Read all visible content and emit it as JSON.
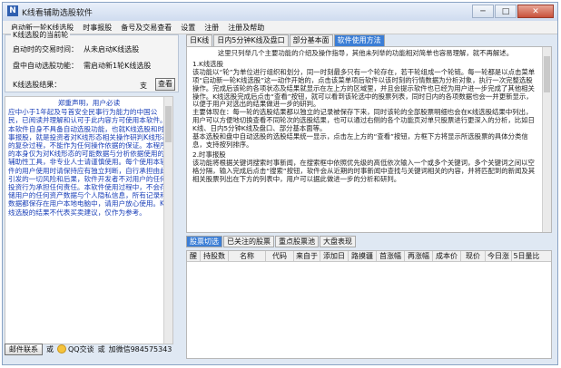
{
  "window": {
    "title": "K线看辅助选股软件",
    "minimize": "─",
    "maximize": "□",
    "close": "✕"
  },
  "menu": [
    "启动新一轮K线选股",
    "时事报股",
    "备号及交易查看",
    "设置",
    "注册",
    "注册及帮助"
  ],
  "left": {
    "group_title": "K线选股的当前轮",
    "start_time_label": "启动时的交易时间：",
    "start_time_value": "从未启动K线选股",
    "step_label": "盘中自动选股功能：",
    "step_value": "需启动新1轮K线选股",
    "result_label": "K线选股结果：",
    "result_value": "支",
    "view_button": "查看",
    "notice_title": "郑重声明，用户必读",
    "notice_text": "应中小于1年起及号首安全民事行为能力的中国公民，已阅读并理解和认可于此内容方可使用本软件。本软件自身不具备自动选股功能，也就K线选股和时事报股，就是投资者对K线形态相关操作研判K线形态的复杂过程，不能作为任何操作依据的保证。本程序的本身仅为对K线形态的可能数据与分析依据使用的辅助性工具，非专业人士请谨慎使用。每个使用本软件的用户使用时请保持应有独立判断，自行承担由此引发的一切风险和后果，软件开发者不对用户的任何投资行为承担任何责任。本软件使用过程中，不会存储用户的任何资产数据与个人隐私信息，所有记录和数据都保存在用户本地电脑中，请用户放心使用。K线选股的结果不代表买卖建议，仅作为参考。"
  },
  "bottom": {
    "open_button": "邮件联系",
    "or1": "或",
    "qq_label": "QQ交谈",
    "or2": "或",
    "wechat_text": "加微信984575343"
  },
  "right": {
    "tabs": [
      "日K线",
      "日内5分钟K线及盘口",
      "部分基本面",
      "软件使用方法"
    ],
    "active_tab": 3,
    "article_intro": "这里只列举几个主要功能的介绍及操作指导，其他未列举的功能相对简单也容易理解，就不再解述。",
    "article_h1": "1.K线选股",
    "article_p1": "该功能以“轮”为单位进行组织和划分，同一时刻最多只有一个轮存在，若干轮组成一个轮链。每一轮都是以点击菜单项“启动新一轮K线选股”这一动作开始的，点击该菜单项后软件以该时刻的行情数据为分析对象，执行一次完整选股操作。完成后该轮的各项状态及结果就显示在左上方的区域里，并且会提示软件也已经为用户进一步完成了其他相关操作。K线选股完成后点击“查看”按钮，就可以看到该轮选中的股票列表，同时日内的各项数据也会一并更新显示，以便于用户对选出的结果做进一步的研判。",
    "article_p2": "主要体现在：每一轮的选股结果都以独立的记录被保存下来，同时该轮的全部股票明细也会在K线选股结果中列出，用户可以方便地切换查看不同轮次的选股结果，也可以通过右侧的各个功能页对单只股票进行更深入的分析，比如日K线、日内5分钟K线及盘口、部分基本面等。",
    "article_p3": "基本选股和盘中自动选股的选股结果统一显示，点击左上方的“查看”按钮，方框下方将显示所选股票的具体分类信息，支持按列排序。",
    "article_h2": "2.时事报股",
    "article_p4": "该功能将根据关键词搜索时事新闻，在搜索框中依照优先级的高低依次输入一个或多个关键词，多个关键词之间以空格分隔，输入完成后点击“搜索”按钮，软件会从近期的时事新闻中查找与关键词相关的内容，并将匹配到的新闻及其相关股票列出在下方的列表中，用户可以据此做进一步的分析和研判。",
    "bottom_tabs": [
      "股票切选",
      "已关注的股票",
      "重点股票池",
      "大盘表现"
    ],
    "columns": [
      "醒",
      "持股数",
      "名称",
      "代码",
      "来自于",
      "添加日",
      "路摸疆",
      "首涨幅",
      "再涨幅",
      "成本价",
      "现价",
      "今日涨",
      "5日量比"
    ]
  }
}
